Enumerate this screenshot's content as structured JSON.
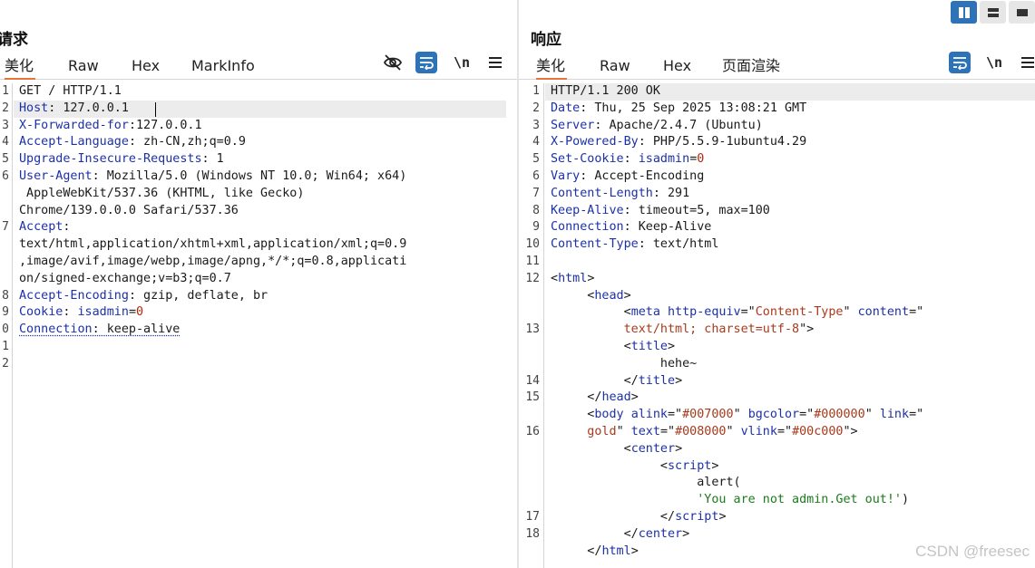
{
  "request": {
    "title": "请求",
    "tabs": [
      "美化",
      "Raw",
      "Hex",
      "MarkInfo"
    ],
    "active_tab": "美化",
    "tools": [
      "eye-off-icon",
      "wrap-icon",
      "newline-toggle",
      "menu-icon"
    ],
    "newline_label": "\\n",
    "line_numbers": [
      "1",
      "2",
      "3",
      "4",
      "5",
      "6",
      "",
      "",
      "7",
      "",
      "",
      "",
      "8",
      "9",
      "0",
      "1",
      "2"
    ],
    "lines": [
      [
        {
          "t": "GET / HTTP/1.1",
          "c": "v"
        }
      ],
      [
        {
          "t": "Host",
          "c": "k"
        },
        {
          "t": ": 127.0.0.1",
          "c": "v"
        }
      ],
      [
        {
          "t": "X-Forwarded-for",
          "c": "k"
        },
        {
          "t": ":127.0.0.1",
          "c": "v"
        }
      ],
      [
        {
          "t": "Accept-Language",
          "c": "k"
        },
        {
          "t": ": zh-CN,zh;q=0.9",
          "c": "v"
        }
      ],
      [
        {
          "t": "Upgrade-Insecure-Requests",
          "c": "k"
        },
        {
          "t": ": 1",
          "c": "v"
        }
      ],
      [
        {
          "t": "User-Agent",
          "c": "k"
        },
        {
          "t": ": Mozilla/5.0 (Windows NT 10.0; Win64; x64)",
          "c": "v"
        }
      ],
      [
        {
          "t": " AppleWebKit/537.36 (KHTML, like Gecko)",
          "c": "v"
        }
      ],
      [
        {
          "t": "Chrome/139.0.0.0 Safari/537.36",
          "c": "v"
        }
      ],
      [
        {
          "t": "Accept",
          "c": "k"
        },
        {
          "t": ":",
          "c": "v"
        }
      ],
      [
        {
          "t": "text/html,application/xhtml+xml,application/xml;q=0.9",
          "c": "v"
        }
      ],
      [
        {
          "t": ",image/avif,image/webp,image/apng,*/*;q=0.8,applicati",
          "c": "v"
        }
      ],
      [
        {
          "t": "on/signed-exchange;v=b3;q=0.7",
          "c": "v"
        }
      ],
      [
        {
          "t": "Accept-Encoding",
          "c": "k"
        },
        {
          "t": ": gzip, deflate, br",
          "c": "v"
        }
      ],
      [
        {
          "t": "Cookie",
          "c": "k"
        },
        {
          "t": ": ",
          "c": "v"
        },
        {
          "t": "isadmin",
          "c": "k"
        },
        {
          "t": "=",
          "c": "v"
        },
        {
          "t": "0",
          "c": "red"
        }
      ],
      [
        {
          "t": "Connection",
          "c": "k squiggle"
        },
        {
          "t": ": keep-alive",
          "c": "v squiggle"
        }
      ],
      [],
      []
    ]
  },
  "response": {
    "title": "响应",
    "tabs": [
      "美化",
      "Raw",
      "Hex",
      "页面渲染"
    ],
    "active_tab": "美化",
    "tools": [
      "wrap-icon",
      "newline-toggle",
      "menu-icon"
    ],
    "newline_label": "\\n",
    "line_numbers": [
      "1",
      "2",
      "3",
      "4",
      "5",
      "6",
      "7",
      "8",
      "9",
      "10",
      "11",
      "12",
      "",
      "",
      "13",
      "",
      "",
      "14",
      "15",
      "",
      "16",
      "",
      "",
      "",
      "",
      "17",
      "18"
    ],
    "lines": [
      [
        {
          "t": "HTTP/1.1 200 OK",
          "c": "v"
        }
      ],
      [
        {
          "t": "Date",
          "c": "k"
        },
        {
          "t": ": Thu, 25 Sep 2025 13:08:21 GMT",
          "c": "v"
        }
      ],
      [
        {
          "t": "Server",
          "c": "k"
        },
        {
          "t": ": Apache/2.4.7 (Ubuntu)",
          "c": "v"
        }
      ],
      [
        {
          "t": "X-Powered-By",
          "c": "k"
        },
        {
          "t": ": PHP/5.5.9-1ubuntu4.29",
          "c": "v"
        }
      ],
      [
        {
          "t": "Set-Cookie",
          "c": "k"
        },
        {
          "t": ": ",
          "c": "v"
        },
        {
          "t": "isadmin",
          "c": "k"
        },
        {
          "t": "=",
          "c": "v"
        },
        {
          "t": "0",
          "c": "red"
        }
      ],
      [
        {
          "t": "Vary",
          "c": "k"
        },
        {
          "t": ": Accept-Encoding",
          "c": "v"
        }
      ],
      [
        {
          "t": "Content-Length",
          "c": "k"
        },
        {
          "t": ": 291",
          "c": "v"
        }
      ],
      [
        {
          "t": "Keep-Alive",
          "c": "k"
        },
        {
          "t": ": timeout=5, max=100",
          "c": "v"
        }
      ],
      [
        {
          "t": "Connection",
          "c": "k"
        },
        {
          "t": ": Keep-Alive",
          "c": "v"
        }
      ],
      [
        {
          "t": "Content-Type",
          "c": "k"
        },
        {
          "t": ": text/html",
          "c": "v"
        }
      ],
      [],
      [
        {
          "t": "<",
          "c": "v"
        },
        {
          "t": "html",
          "c": "tag"
        },
        {
          "t": ">",
          "c": "v"
        }
      ],
      [
        {
          "t": "     <",
          "c": "v"
        },
        {
          "t": "head",
          "c": "tag"
        },
        {
          "t": ">",
          "c": "v"
        }
      ],
      [
        {
          "t": "          <",
          "c": "v"
        },
        {
          "t": "meta",
          "c": "tag"
        },
        {
          "t": " ",
          "c": "v"
        },
        {
          "t": "http-equiv",
          "c": "attr"
        },
        {
          "t": "=\"",
          "c": "v"
        },
        {
          "t": "Content-Type",
          "c": "aval"
        },
        {
          "t": "\" ",
          "c": "v"
        },
        {
          "t": "content",
          "c": "attr"
        },
        {
          "t": "=\"",
          "c": "v"
        }
      ],
      [
        {
          "t": "          text/html; charset=utf-8",
          "c": "aval"
        },
        {
          "t": "\">",
          "c": "v"
        }
      ],
      [
        {
          "t": "          <",
          "c": "v"
        },
        {
          "t": "title",
          "c": "tag"
        },
        {
          "t": ">",
          "c": "v"
        }
      ],
      [
        {
          "t": "               hehe~",
          "c": "v"
        }
      ],
      [
        {
          "t": "          </",
          "c": "v"
        },
        {
          "t": "title",
          "c": "tag"
        },
        {
          "t": ">",
          "c": "v"
        }
      ],
      [
        {
          "t": "     </",
          "c": "v"
        },
        {
          "t": "head",
          "c": "tag"
        },
        {
          "t": ">",
          "c": "v"
        }
      ],
      [
        {
          "t": "     <",
          "c": "v"
        },
        {
          "t": "body",
          "c": "tag"
        },
        {
          "t": " ",
          "c": "v"
        },
        {
          "t": "alink",
          "c": "attr"
        },
        {
          "t": "=\"",
          "c": "v"
        },
        {
          "t": "#007000",
          "c": "aval"
        },
        {
          "t": "\" ",
          "c": "v"
        },
        {
          "t": "bgcolor",
          "c": "attr"
        },
        {
          "t": "=\"",
          "c": "v"
        },
        {
          "t": "#000000",
          "c": "aval"
        },
        {
          "t": "\" ",
          "c": "v"
        },
        {
          "t": "link",
          "c": "attr"
        },
        {
          "t": "=\"",
          "c": "v"
        }
      ],
      [
        {
          "t": "     gold",
          "c": "aval"
        },
        {
          "t": "\" ",
          "c": "v"
        },
        {
          "t": "text",
          "c": "attr"
        },
        {
          "t": "=\"",
          "c": "v"
        },
        {
          "t": "#008000",
          "c": "aval"
        },
        {
          "t": "\" ",
          "c": "v"
        },
        {
          "t": "vlink",
          "c": "attr"
        },
        {
          "t": "=\"",
          "c": "v"
        },
        {
          "t": "#00c000",
          "c": "aval"
        },
        {
          "t": "\">",
          "c": "v"
        }
      ],
      [
        {
          "t": "          <",
          "c": "v"
        },
        {
          "t": "center",
          "c": "tag"
        },
        {
          "t": ">",
          "c": "v"
        }
      ],
      [
        {
          "t": "               <",
          "c": "v"
        },
        {
          "t": "script",
          "c": "tag"
        },
        {
          "t": ">",
          "c": "v"
        }
      ],
      [
        {
          "t": "                    alert(",
          "c": "v"
        }
      ],
      [
        {
          "t": "                    'You are not admin.Get out!'",
          "c": "str"
        },
        {
          "t": ")",
          "c": "v"
        }
      ],
      [
        {
          "t": "               </",
          "c": "v"
        },
        {
          "t": "script",
          "c": "tag"
        },
        {
          "t": ">",
          "c": "v"
        }
      ],
      [
        {
          "t": "          </",
          "c": "v"
        },
        {
          "t": "center",
          "c": "tag"
        },
        {
          "t": ">",
          "c": "v"
        }
      ],
      [
        {
          "t": "     </",
          "c": "v"
        },
        {
          "t": "html",
          "c": "tag"
        },
        {
          "t": ">",
          "c": "v"
        }
      ],
      []
    ]
  },
  "layout_toggle": [
    "split-columns-icon",
    "split-rows-icon",
    "single-pane-icon"
  ],
  "watermark": "CSDN @freesec",
  "colors": {
    "accent": "#e8743b",
    "button_blue": "#2e73b8",
    "header_key": "#1c31a6"
  }
}
